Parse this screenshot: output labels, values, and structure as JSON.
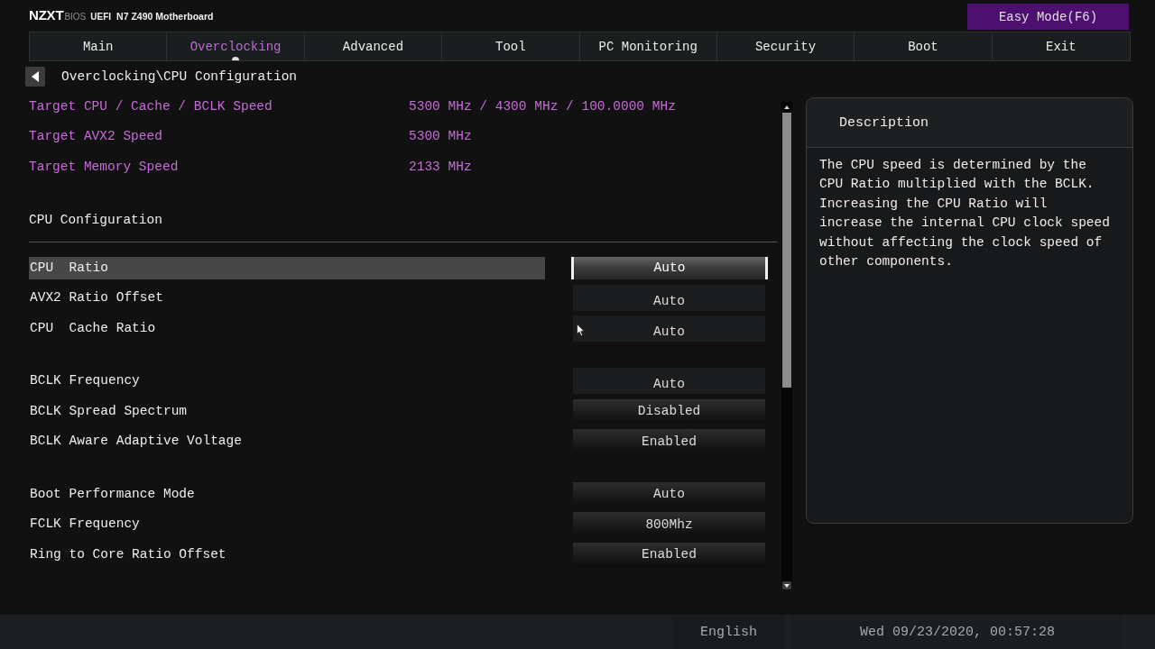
{
  "header": {
    "logo": "NZXT",
    "product": "BIOS",
    "firmware": "UEFI",
    "board": "N7 Z490 Motherboard",
    "mode_button": "Easy Mode(F6)"
  },
  "tabs": [
    {
      "label": "Main",
      "selected": false
    },
    {
      "label": "Overclocking",
      "selected": true
    },
    {
      "label": "Advanced",
      "selected": false
    },
    {
      "label": "Tool",
      "selected": false
    },
    {
      "label": "PC Monitoring",
      "selected": false
    },
    {
      "label": "Security",
      "selected": false
    },
    {
      "label": "Boot",
      "selected": false
    },
    {
      "label": "Exit",
      "selected": false
    }
  ],
  "breadcrumb": {
    "path": "Overclocking\\CPU Configuration"
  },
  "targets": [
    {
      "label": "Target CPU / Cache / BCLK Speed",
      "value": "5300 MHz / 4300 MHz / 100.0000 MHz"
    },
    {
      "label": "Target AVX2 Speed",
      "value": "5300 MHz"
    },
    {
      "label": "Target Memory Speed",
      "value": "2133 MHz"
    }
  ],
  "section": {
    "title": "CPU Configuration",
    "groups": [
      {
        "settings": [
          {
            "label": "CPU  Ratio",
            "value": "Auto",
            "kind": "input",
            "selected": true
          },
          {
            "label": "AVX2 Ratio Offset",
            "value": "Auto",
            "kind": "input",
            "selected": false
          },
          {
            "label": "CPU  Cache Ratio",
            "value": "Auto",
            "kind": "input",
            "selected": false
          }
        ]
      },
      {
        "settings": [
          {
            "label": "BCLK Frequency",
            "value": "Auto",
            "kind": "input",
            "selected": false
          },
          {
            "label": "BCLK Spread Spectrum",
            "value": "Disabled",
            "kind": "select",
            "selected": false
          },
          {
            "label": "BCLK Aware Adaptive Voltage",
            "value": "Enabled",
            "kind": "select",
            "selected": false
          }
        ]
      },
      {
        "settings": [
          {
            "label": "Boot Performance Mode",
            "value": "Auto",
            "kind": "select",
            "selected": false
          },
          {
            "label": "FCLK Frequency",
            "value": "800Mhz",
            "kind": "select",
            "selected": false
          },
          {
            "label": "Ring to Core Ratio Offset",
            "value": "Enabled",
            "kind": "select",
            "selected": false
          }
        ]
      }
    ]
  },
  "description": {
    "title": "Description",
    "text": "The CPU speed is determined by the CPU Ratio multiplied with the BCLK. Increasing the CPU Ratio will increase the internal CPU clock speed without affecting the clock speed of other components."
  },
  "status_bar": {
    "language": "English",
    "datetime": "Wed 09/23/2020, 00:57:28"
  }
}
